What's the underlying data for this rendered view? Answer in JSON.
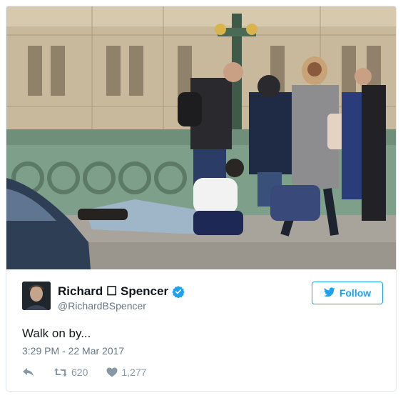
{
  "tweet": {
    "display_name": "Richard ☐ Spencer",
    "handle": "@RichardBSpencer",
    "follow_label": "Follow",
    "text": "Walk on by...",
    "timestamp": "3:29 PM - 22 Mar 2017",
    "retweet_count": "620",
    "like_count": "1,277",
    "verified": true
  },
  "icons": {
    "reply": "reply-icon",
    "retweet": "retweet-icon",
    "like": "heart-icon",
    "follow": "twitter-bird-icon",
    "verified": "verified-badge-icon"
  },
  "colors": {
    "accent": "#1da1f2",
    "muted": "#657786",
    "action": "#8899a6"
  }
}
